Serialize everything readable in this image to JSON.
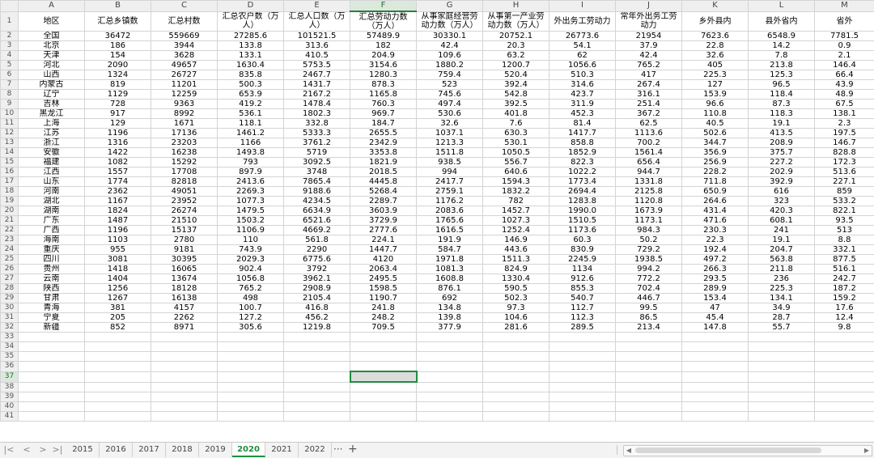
{
  "columns": [
    "A",
    "B",
    "C",
    "D",
    "E",
    "F",
    "G",
    "H",
    "I",
    "J",
    "K",
    "L",
    "M"
  ],
  "selected_column": "F",
  "selected_row": 37,
  "headers": [
    "地区",
    "汇总乡镇数",
    "汇总村数",
    "汇总农户数（万人）",
    "汇总人口数（万人）",
    "汇总劳动力数（万人）",
    "从事家庭经营劳动力数（万人）",
    "从事第一产业劳动力数（万人）",
    "外出务工劳动力",
    "常年外出务工劳动力",
    "乡外县内",
    "县外省内",
    "省外"
  ],
  "rows": [
    [
      "全国",
      "36472",
      "559669",
      "27285.6",
      "101521.5",
      "57489.9",
      "30330.1",
      "20752.1",
      "26773.6",
      "21954",
      "7623.6",
      "6548.9",
      "7781.5"
    ],
    [
      "北京",
      "186",
      "3944",
      "133.8",
      "313.6",
      "182",
      "42.4",
      "20.3",
      "54.1",
      "37.9",
      "22.8",
      "14.2",
      "0.9"
    ],
    [
      "天津",
      "154",
      "3628",
      "133.1",
      "410.5",
      "204.9",
      "109.6",
      "63.2",
      "62",
      "42.4",
      "32.6",
      "7.8",
      "2.1"
    ],
    [
      "河北",
      "2090",
      "49657",
      "1630.4",
      "5753.5",
      "3154.6",
      "1880.2",
      "1200.7",
      "1056.6",
      "765.2",
      "405",
      "213.8",
      "146.4"
    ],
    [
      "山西",
      "1324",
      "26727",
      "835.8",
      "2467.7",
      "1280.3",
      "759.4",
      "520.4",
      "510.3",
      "417",
      "225.3",
      "125.3",
      "66.4"
    ],
    [
      "内蒙古",
      "819",
      "11201",
      "500.3",
      "1431.7",
      "878.3",
      "523",
      "392.4",
      "314.6",
      "267.4",
      "127",
      "96.5",
      "43.9"
    ],
    [
      "辽宁",
      "1129",
      "12259",
      "653.9",
      "2167.2",
      "1165.8",
      "745.6",
      "542.8",
      "423.7",
      "316.1",
      "153.9",
      "118.4",
      "48.9"
    ],
    [
      "吉林",
      "728",
      "9363",
      "419.2",
      "1478.4",
      "760.3",
      "497.4",
      "392.5",
      "311.9",
      "251.4",
      "96.6",
      "87.3",
      "67.5"
    ],
    [
      "黑龙江",
      "917",
      "8992",
      "536.1",
      "1802.3",
      "969.7",
      "530.6",
      "401.8",
      "452.3",
      "367.2",
      "110.8",
      "118.3",
      "138.1"
    ],
    [
      "上海",
      "129",
      "1671",
      "118.1",
      "332.8",
      "184.7",
      "32.6",
      "7.6",
      "81.4",
      "62.5",
      "40.5",
      "19.1",
      "2.3"
    ],
    [
      "江苏",
      "1196",
      "17136",
      "1461.2",
      "5333.3",
      "2655.5",
      "1037.1",
      "630.3",
      "1417.7",
      "1113.6",
      "502.6",
      "413.5",
      "197.5"
    ],
    [
      "浙江",
      "1316",
      "23203",
      "1166",
      "3761.2",
      "2342.9",
      "1213.3",
      "530.1",
      "858.8",
      "700.2",
      "344.7",
      "208.9",
      "146.7"
    ],
    [
      "安徽",
      "1422",
      "16238",
      "1493.8",
      "5719",
      "3353.8",
      "1511.8",
      "1050.5",
      "1852.9",
      "1561.4",
      "356.9",
      "375.7",
      "828.8"
    ],
    [
      "福建",
      "1082",
      "15292",
      "793",
      "3092.5",
      "1821.9",
      "938.5",
      "556.7",
      "822.3",
      "656.4",
      "256.9",
      "227.2",
      "172.3"
    ],
    [
      "江西",
      "1557",
      "17708",
      "897.9",
      "3748",
      "2018.5",
      "994",
      "640.6",
      "1022.2",
      "944.7",
      "228.2",
      "202.9",
      "513.6"
    ],
    [
      "山东",
      "1774",
      "82818",
      "2413.6",
      "7865.4",
      "4445.8",
      "2417.7",
      "1594.3",
      "1773.4",
      "1331.8",
      "711.8",
      "392.9",
      "227.1"
    ],
    [
      "河南",
      "2362",
      "49051",
      "2269.3",
      "9188.6",
      "5268.4",
      "2759.1",
      "1832.2",
      "2694.4",
      "2125.8",
      "650.9",
      "616",
      "859"
    ],
    [
      "湖北",
      "1167",
      "23952",
      "1077.3",
      "4234.5",
      "2289.7",
      "1176.2",
      "782",
      "1283.8",
      "1120.8",
      "264.6",
      "323",
      "533.2"
    ],
    [
      "湖南",
      "1824",
      "26274",
      "1479.5",
      "6634.9",
      "3603.9",
      "2083.6",
      "1452.7",
      "1990.0",
      "1673.9",
      "431.4",
      "420.3",
      "822.1"
    ],
    [
      "广东",
      "1487",
      "21510",
      "1503.2",
      "6521.6",
      "3729.9",
      "1765.6",
      "1027.3",
      "1510.5",
      "1173.1",
      "471.6",
      "608.1",
      "93.5"
    ],
    [
      "广西",
      "1196",
      "15137",
      "1106.9",
      "4669.2",
      "2777.6",
      "1616.5",
      "1252.4",
      "1173.6",
      "984.3",
      "230.3",
      "241",
      "513"
    ],
    [
      "海南",
      "1103",
      "2780",
      "110",
      "561.8",
      "224.1",
      "191.9",
      "146.9",
      "60.3",
      "50.2",
      "22.3",
      "19.1",
      "8.8"
    ],
    [
      "重庆",
      "955",
      "9181",
      "743.9",
      "2290",
      "1447.7",
      "584.7",
      "443.6",
      "830.9",
      "729.2",
      "192.4",
      "204.7",
      "332.1"
    ],
    [
      "四川",
      "3081",
      "30395",
      "2029.3",
      "6775.6",
      "4120",
      "1971.8",
      "1511.3",
      "2245.9",
      "1938.5",
      "497.2",
      "563.8",
      "877.5"
    ],
    [
      "贵州",
      "1418",
      "16065",
      "902.4",
      "3792",
      "2063.4",
      "1081.3",
      "824.9",
      "1134",
      "994.2",
      "266.3",
      "211.8",
      "516.1"
    ],
    [
      "云南",
      "1404",
      "13674",
      "1056.8",
      "3962.1",
      "2495.5",
      "1608.8",
      "1330.4",
      "912.6",
      "772.2",
      "293.5",
      "236",
      "242.7"
    ],
    [
      "陕西",
      "1256",
      "18128",
      "765.2",
      "2908.9",
      "1598.5",
      "876.1",
      "590.5",
      "855.3",
      "702.4",
      "289.9",
      "225.3",
      "187.2"
    ],
    [
      "甘肃",
      "1267",
      "16138",
      "498",
      "2105.4",
      "1190.7",
      "692",
      "502.3",
      "540.7",
      "446.7",
      "153.4",
      "134.1",
      "159.2"
    ],
    [
      "青海",
      "381",
      "4157",
      "100.7",
      "416.8",
      "241.8",
      "134.8",
      "97.3",
      "112.7",
      "99.5",
      "47",
      "34.9",
      "17.6"
    ],
    [
      "宁夏",
      "205",
      "2262",
      "127.2",
      "456.2",
      "248.2",
      "139.8",
      "104.6",
      "112.3",
      "86.5",
      "45.4",
      "28.7",
      "12.4"
    ],
    [
      "新疆",
      "852",
      "8971",
      "305.6",
      "1219.8",
      "709.5",
      "377.9",
      "281.6",
      "289.5",
      "213.4",
      "147.8",
      "55.7",
      "9.8"
    ]
  ],
  "empty_rows": [
    33,
    34,
    35,
    36,
    37,
    38,
    39,
    40,
    41
  ],
  "sheet_tabs": [
    "2015",
    "2016",
    "2017",
    "2018",
    "2019",
    "2020",
    "2021",
    "2022"
  ],
  "active_tab": "2020",
  "tab_more": "···",
  "tab_add": "+",
  "nav": {
    "first": "|<",
    "prev": "<",
    "next": ">",
    "last": ">|"
  }
}
